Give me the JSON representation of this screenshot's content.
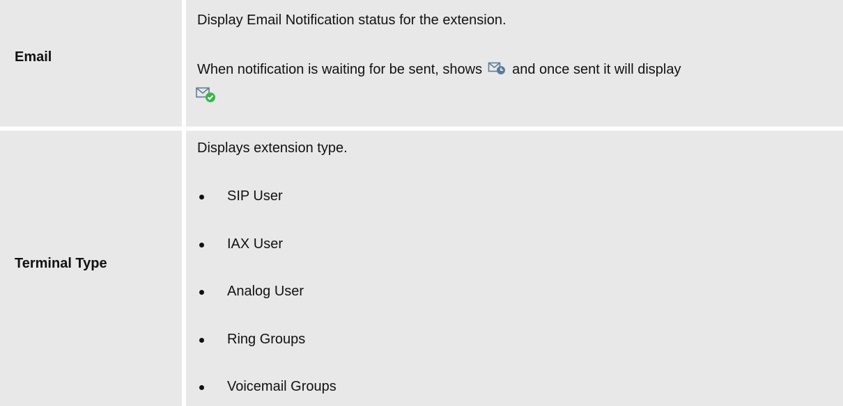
{
  "rows": [
    {
      "label": "Email",
      "desc_line1": "Display Email Notification status for the extension.",
      "desc_line2_before": "When notification is waiting for be sent, shows",
      "desc_line2_after": "and once sent it will display",
      "icons": [
        "mail-pending-icon",
        "mail-sent-icon"
      ]
    },
    {
      "label": "Terminal Type",
      "desc_line1": "Displays extension type.",
      "items": [
        "SIP User",
        "IAX User",
        "Analog User",
        "Ring Groups",
        "Voicemail Groups"
      ]
    }
  ],
  "colors": {
    "cell_background": "#e8e8e8",
    "text": "#111111",
    "icon_blue": "#5b7c99",
    "icon_green": "#3ab54a"
  }
}
